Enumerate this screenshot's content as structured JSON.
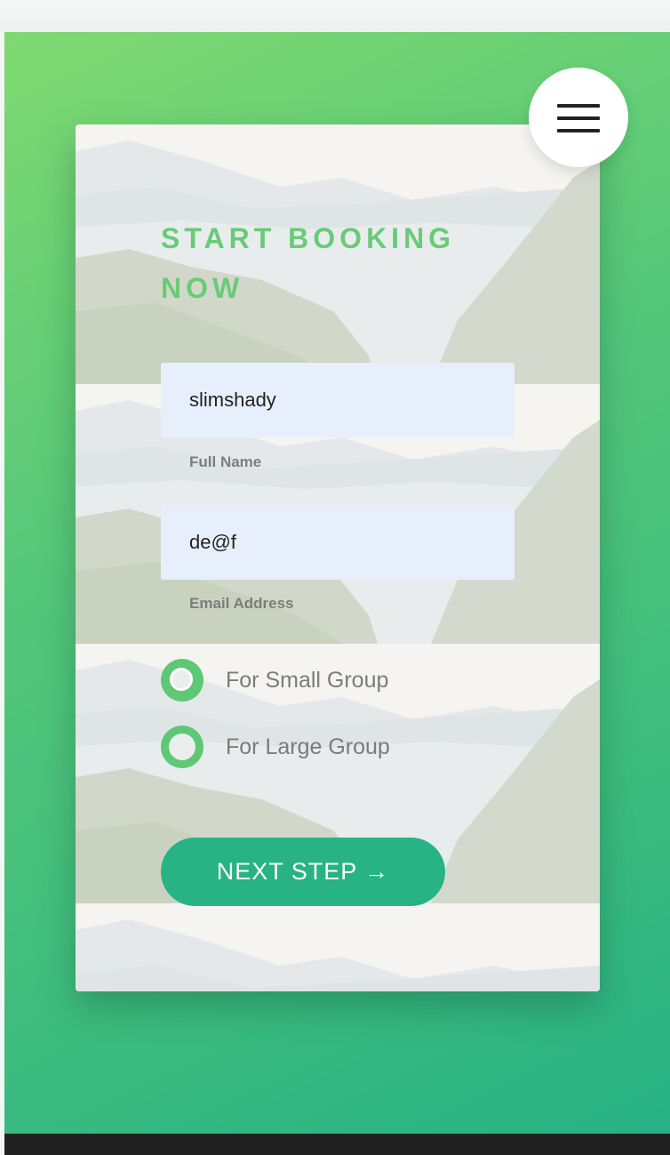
{
  "booking": {
    "title": "START BOOKING NOW",
    "full_name": {
      "value": "slimshady",
      "label": "Full Name"
    },
    "email": {
      "value": "de@f",
      "label": "Email Address"
    },
    "group_options": [
      {
        "label": "For Small Group",
        "selected": true
      },
      {
        "label": "For Large Group",
        "selected": false
      }
    ],
    "next_button": "NEXT STEP →"
  },
  "menu": {
    "icon": "hamburger-menu-icon"
  },
  "colors": {
    "accent_green": "#68cb78",
    "radio_green": "#5ec874",
    "button_teal": "#27b384",
    "input_bg": "#e8effc",
    "gradient_start": "#7fd971",
    "gradient_end": "#27b185"
  }
}
